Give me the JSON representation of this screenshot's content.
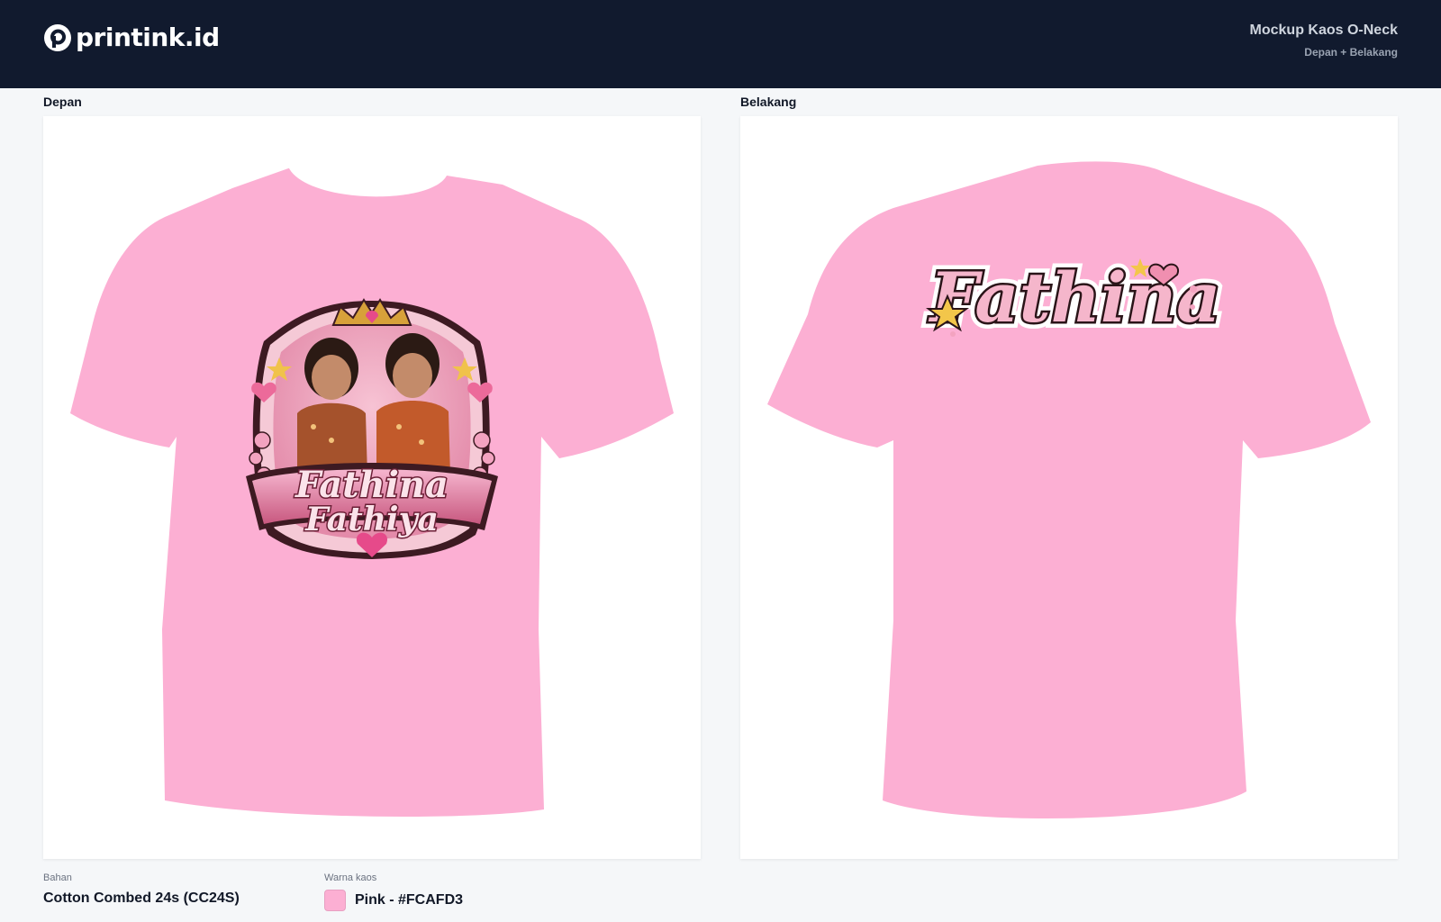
{
  "header": {
    "brand": "printink.id",
    "title": "Mockup Kaos O-Neck",
    "subtitle": "Depan + Belakang"
  },
  "panels": {
    "front": {
      "label": "Depan",
      "print_title_1": "Fathina",
      "print_title_2": "Fathiya"
    },
    "back": {
      "label": "Belakang",
      "print_title": "Fathina"
    }
  },
  "specs": {
    "material": {
      "label": "Bahan",
      "value": "Cotton Combed 24s (CC24S)"
    },
    "color": {
      "label": "Warna kaos",
      "value": "Pink - #FCAFD3",
      "swatch": "#FCAFD3"
    }
  },
  "colors": {
    "header_bg": "#111A2E",
    "shirt": "#FCAFD3",
    "accent": "#E64A8A"
  },
  "icons": [
    "printink-logo-icon",
    "star-icon",
    "heart-icon",
    "crown-icon"
  ]
}
